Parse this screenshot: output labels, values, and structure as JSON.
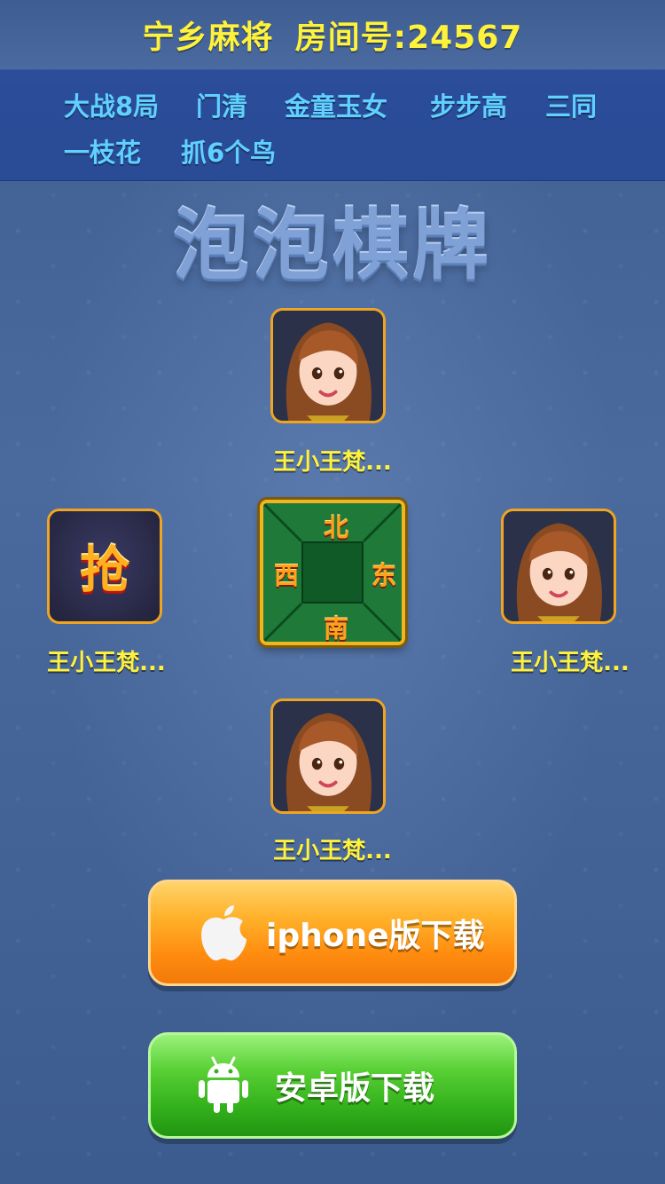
{
  "header": {
    "game_name": "宁乡麻将",
    "room_label": "房间号:24567"
  },
  "rules": [
    "大战8局",
    "门清",
    "金童玉女",
    "步步高",
    "三同",
    "一枝花",
    "抓6个鸟"
  ],
  "logo": {
    "text": "泡泡棋牌"
  },
  "players": {
    "top": {
      "name": "王小王梵..."
    },
    "left": {
      "name": "王小王梵...",
      "badge": "抢"
    },
    "right": {
      "name": "王小王梵..."
    },
    "bottom": {
      "name": "王小王梵..."
    }
  },
  "compass": {
    "north": "北",
    "south": "南",
    "east": "东",
    "west": "西"
  },
  "buttons": {
    "ios": {
      "label": "iphone版下载",
      "icon": "apple-icon"
    },
    "android": {
      "label": "安卓版下载",
      "icon": "android-icon"
    }
  },
  "colors": {
    "header_text": "#fff23a",
    "rules_text": "#5fd0ff",
    "ios_button": "#ff8d10",
    "android_button": "#34b21c",
    "avatar_border": "#f0a522"
  }
}
